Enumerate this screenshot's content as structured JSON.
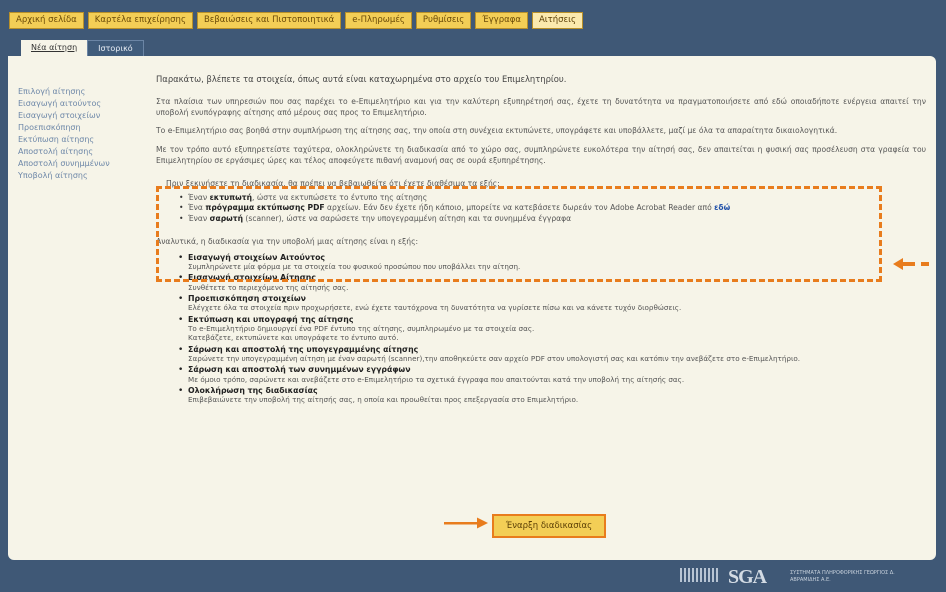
{
  "topnav": [
    {
      "label": "Αρχική σελίδα",
      "active": false
    },
    {
      "label": "Καρτέλα επιχείρησης",
      "active": false
    },
    {
      "label": "Βεβαιώσεις και Πιστοποιητικά",
      "active": false
    },
    {
      "label": "e-Πληρωμές",
      "active": false
    },
    {
      "label": "Ρυθμίσεις",
      "active": false
    },
    {
      "label": "Έγγραφα",
      "active": false
    },
    {
      "label": "Αιτήσεις",
      "active": true
    }
  ],
  "subtabs": [
    {
      "label": "Νέα αίτηση",
      "active": true
    },
    {
      "label": "Ιστορικό",
      "active": false
    }
  ],
  "sidebar": {
    "items": [
      "Επιλογή αίτησης",
      "Εισαγωγή αιτούντος",
      "Εισαγωγή στοιχείων",
      "Προεπισκόπηση",
      "Εκτύπωση αίτησης",
      "Αποστολή αίτησης",
      "Αποστολή συνημμένων",
      "Υποβολή αίτησης"
    ]
  },
  "content": {
    "lead": "Παρακάτω, βλέπετε τα στοιχεία, όπως αυτά είναι καταχωρημένα στο αρχείο του Επιμελητηρίου.",
    "para1": "Στα πλαίσια των υπηρεσιών που σας παρέχει το e-Επιμελητήριο και για την καλύτερη εξυπηρέτησή σας, έχετε τη δυνατότητα να πραγματοποιήσετε από εδώ οποιαδήποτε ενέργεια απαιτεί την υποβολή ενυπόγραφης αίτησης από μέρους σας προς το Επιμελητήριο.",
    "para2": "Το e-Επιμελητήριο σας βοηθά στην συμπλήρωση της αίτησης σας, την οποία στη συνέχεια εκτυπώνετε, υπογράφετε και υποβάλλετε, μαζί με όλα τα απαραίτητα δικαιολογητικά.",
    "para3": "Με τον τρόπο αυτό εξυπηρετείστε ταχύτερα, ολοκληρώνετε τη διαδικασία από το χώρο σας, συμπληρώνετε ευκολότερα την αίτησή σας, δεν απαιτείται η φυσική σας προσέλευση στα γραφεία του Επιμελητηρίου σε εργάσιμες ώρες και τέλος αποφεύγετε πιθανή αναμονή σας σε ουρά εξυπηρέτησης.",
    "req_intro": "Πριν ξεκινήσετε τη διαδικασία, θα πρέπει να βεβαιωθείτε ότι έχετε διαθέσιμα τα εξής:",
    "req1_pre": "Έναν ",
    "req1_bold": "εκτυπωτή",
    "req1_post": ", ώστε να εκτυπώσετε το έντυπο της αίτησης",
    "req2_pre": "Ένα ",
    "req2_bold": "πρόγραμμα εκτύπωσης PDF",
    "req2_post": " αρχείων. Εάν δεν έχετε ήδη κάποιο, μπορείτε να κατεβάσετε δωρεάν τον Adobe Acrobat Reader από ",
    "req2_link": "εδώ",
    "req3_pre": "Έναν ",
    "req3_bold": "σαρωτή",
    "req3_post": " (scanner), ώστε να σαρώσετε την υπογεγραμμένη αίτηση και τα συνημμένα έγγραφα",
    "steps_intro": "Αναλυτικά, η διαδικασία για την υποβολή μιας αίτησης είναι η εξής:",
    "steps": [
      {
        "title": "Εισαγωγή στοιχείων Αιτούντος",
        "desc": "Συμπληρώνετε μία φόρμα με τα στοιχεία του φυσικού προσώπου που υποβάλλει την αίτηση."
      },
      {
        "title": "Εισαγωγή στοιχείων Αίτησης",
        "desc": "Συνθέτετε το περιεχόμενο της αίτησής σας."
      },
      {
        "title": "Προεπισκόπηση στοιχείων",
        "desc": "Ελέγχετε όλα τα στοιχεία πριν προχωρήσετε, ενώ έχετε ταυτόχρονα τη δυνατότητα να γυρίσετε πίσω και να κάνετε τυχόν διορθώσεις."
      },
      {
        "title": "Εκτύπωση και υπογραφή της αίτησης",
        "desc": "Το e-Επιμελητήριο δημιουργεί ένα PDF έντυπο της αίτησης, συμπληρωμένο με τα στοιχεία σας.\nΚατεβάζετε, εκτυπώνετε και υπογράφετε το έντυπο αυτό."
      },
      {
        "title": "Σάρωση και αποστολή της υπογεγραμμένης αίτησης",
        "desc": "Σαρώνετε την υπογεγραμμένη αίτηση με έναν σαρωτή (scanner),την αποθηκεύετε σαν αρχείο PDF στον υπολογιστή σας και κατόπιν την ανεβάζετε στο e-Επιμελητήριο."
      },
      {
        "title": "Σάρωση και αποστολή των συνημμένων εγγράφων",
        "desc": "Με όμοιο τρόπο, σαρώνετε και ανεβάζετε στο e-Επιμελητήριο τα σχετικά έγγραφα που απαιτούνται κατά την υποβολή της αίτησής σας."
      },
      {
        "title": "Ολοκλήρωση της διαδικασίας",
        "desc": "Επιβεβαιώνετε την υποβολή της αίτησής σας, η οποία και προωθείται προς επεξεργασία στο Επιμελητήριο."
      }
    ],
    "start_button": "Έναρξη διαδικασίας"
  },
  "footer": {
    "logo_text": "SGA",
    "logo_sub": "ΣΥΣΤΗΜΑΤΑ ΠΛΗΡΟΦΟΡΙΚΗΣ ΓΕΩΡΓΙΟΣ Δ. ΑΒΡΑΜΙΔΗΣ Α.Ε."
  },
  "colors": {
    "background": "#3f5876",
    "nav_button": "#f3ce56",
    "highlight": "#e87c1d",
    "panel": "#f6f4e8",
    "sidebar_link": "#6d87a8"
  },
  "icons": {
    "side_arrow": "left-arrow-icon",
    "start_arrow": "right-arrow-icon"
  }
}
